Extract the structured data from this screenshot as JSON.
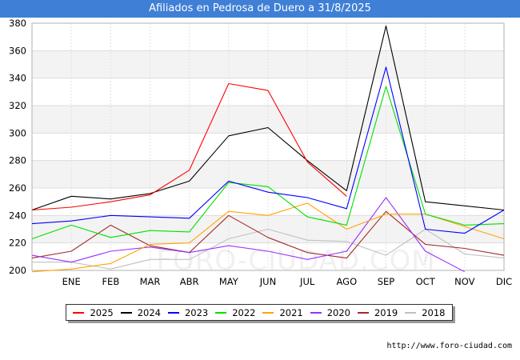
{
  "header": {
    "title": "Afiliados en Pedrosa de Duero a 31/8/2025"
  },
  "source": "http://www.foro-ciudad.com",
  "watermark": "FORO-CIUDAD.COM",
  "chart_data": {
    "type": "line",
    "title": "Afiliados en Pedrosa de Duero a 31/8/2025",
    "categories": [
      "",
      "ENE",
      "FEB",
      "MAR",
      "ABR",
      "MAY",
      "JUN",
      "JUL",
      "AGO",
      "SEP",
      "OCT",
      "NOV",
      "DIC"
    ],
    "ylim": [
      200,
      380
    ],
    "yticks": [
      200,
      220,
      240,
      260,
      280,
      300,
      320,
      340,
      360,
      380
    ],
    "grid": true,
    "legend_position": "bottom",
    "series": [
      {
        "name": "2025",
        "color": "#ff0000",
        "values": [
          244,
          246,
          250,
          255,
          273,
          336,
          331,
          279,
          254,
          null,
          null,
          null,
          null
        ]
      },
      {
        "name": "2024",
        "color": "#000000",
        "values": [
          244,
          254,
          252,
          256,
          265,
          298,
          304,
          280,
          258,
          378,
          250,
          247,
          244
        ]
      },
      {
        "name": "2023",
        "color": "#0000ff",
        "values": [
          234,
          236,
          240,
          239,
          238,
          265,
          257,
          253,
          245,
          348,
          230,
          227,
          244
        ]
      },
      {
        "name": "2022",
        "color": "#00e000",
        "values": [
          223,
          233,
          224,
          229,
          228,
          264,
          261,
          239,
          233,
          334,
          241,
          233,
          234
        ]
      },
      {
        "name": "2021",
        "color": "#ffa500",
        "values": [
          199,
          201,
          205,
          219,
          220,
          243,
          240,
          249,
          230,
          241,
          241,
          232,
          223
        ]
      },
      {
        "name": "2020",
        "color": "#9b30ff",
        "values": [
          211,
          206,
          214,
          217,
          213,
          218,
          214,
          208,
          214,
          253,
          214,
          199,
          null
        ]
      },
      {
        "name": "2019",
        "color": "#a52a2a",
        "values": [
          209,
          214,
          233,
          218,
          213,
          240,
          224,
          213,
          209,
          243,
          219,
          216,
          211
        ]
      },
      {
        "name": "2018",
        "color": "#c0c0c0",
        "values": [
          206,
          206,
          201,
          208,
          208,
          223,
          230,
          222,
          221,
          211,
          230,
          212,
          209
        ]
      }
    ]
  }
}
